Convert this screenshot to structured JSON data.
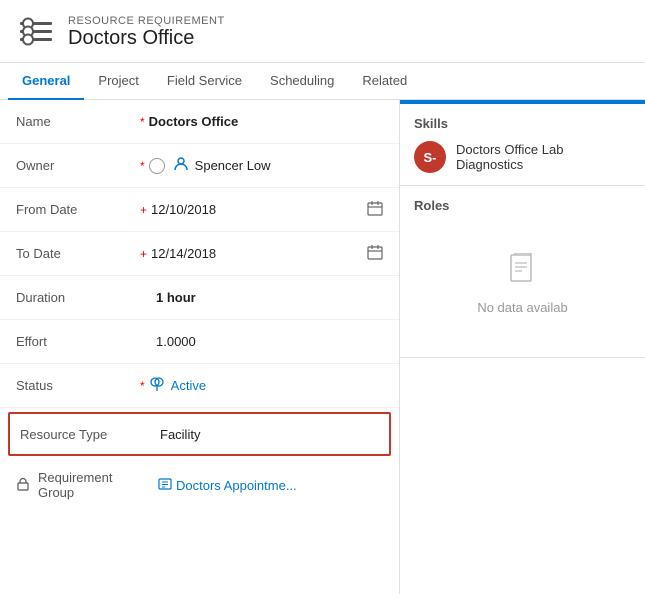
{
  "header": {
    "subtitle": "RESOURCE REQUIREMENT",
    "title": "Doctors Office"
  },
  "nav": {
    "tabs": [
      {
        "label": "General",
        "active": true
      },
      {
        "label": "Project",
        "active": false
      },
      {
        "label": "Field Service",
        "active": false
      },
      {
        "label": "Scheduling",
        "active": false
      },
      {
        "label": "Related",
        "active": false
      }
    ]
  },
  "fields": {
    "name_label": "Name",
    "name_value": "Doctors Office",
    "owner_label": "Owner",
    "owner_value": "Spencer Low",
    "from_date_label": "From Date",
    "from_date_value": "12/10/2018",
    "to_date_label": "To Date",
    "to_date_value": "12/14/2018",
    "duration_label": "Duration",
    "duration_value": "1 hour",
    "effort_label": "Effort",
    "effort_value": "1.0000",
    "status_label": "Status",
    "status_value": "Active",
    "resource_type_label": "Resource Type",
    "resource_type_value": "Facility",
    "req_group_label": "Requirement Group",
    "req_group_value": "Doctors Appointme..."
  },
  "right": {
    "skills_title": "Skills",
    "skill_avatar_text": "S-",
    "skill_name": "Doctors Office Lab Diagnostics",
    "roles_title": "Roles",
    "no_data_text": "No data availab"
  }
}
